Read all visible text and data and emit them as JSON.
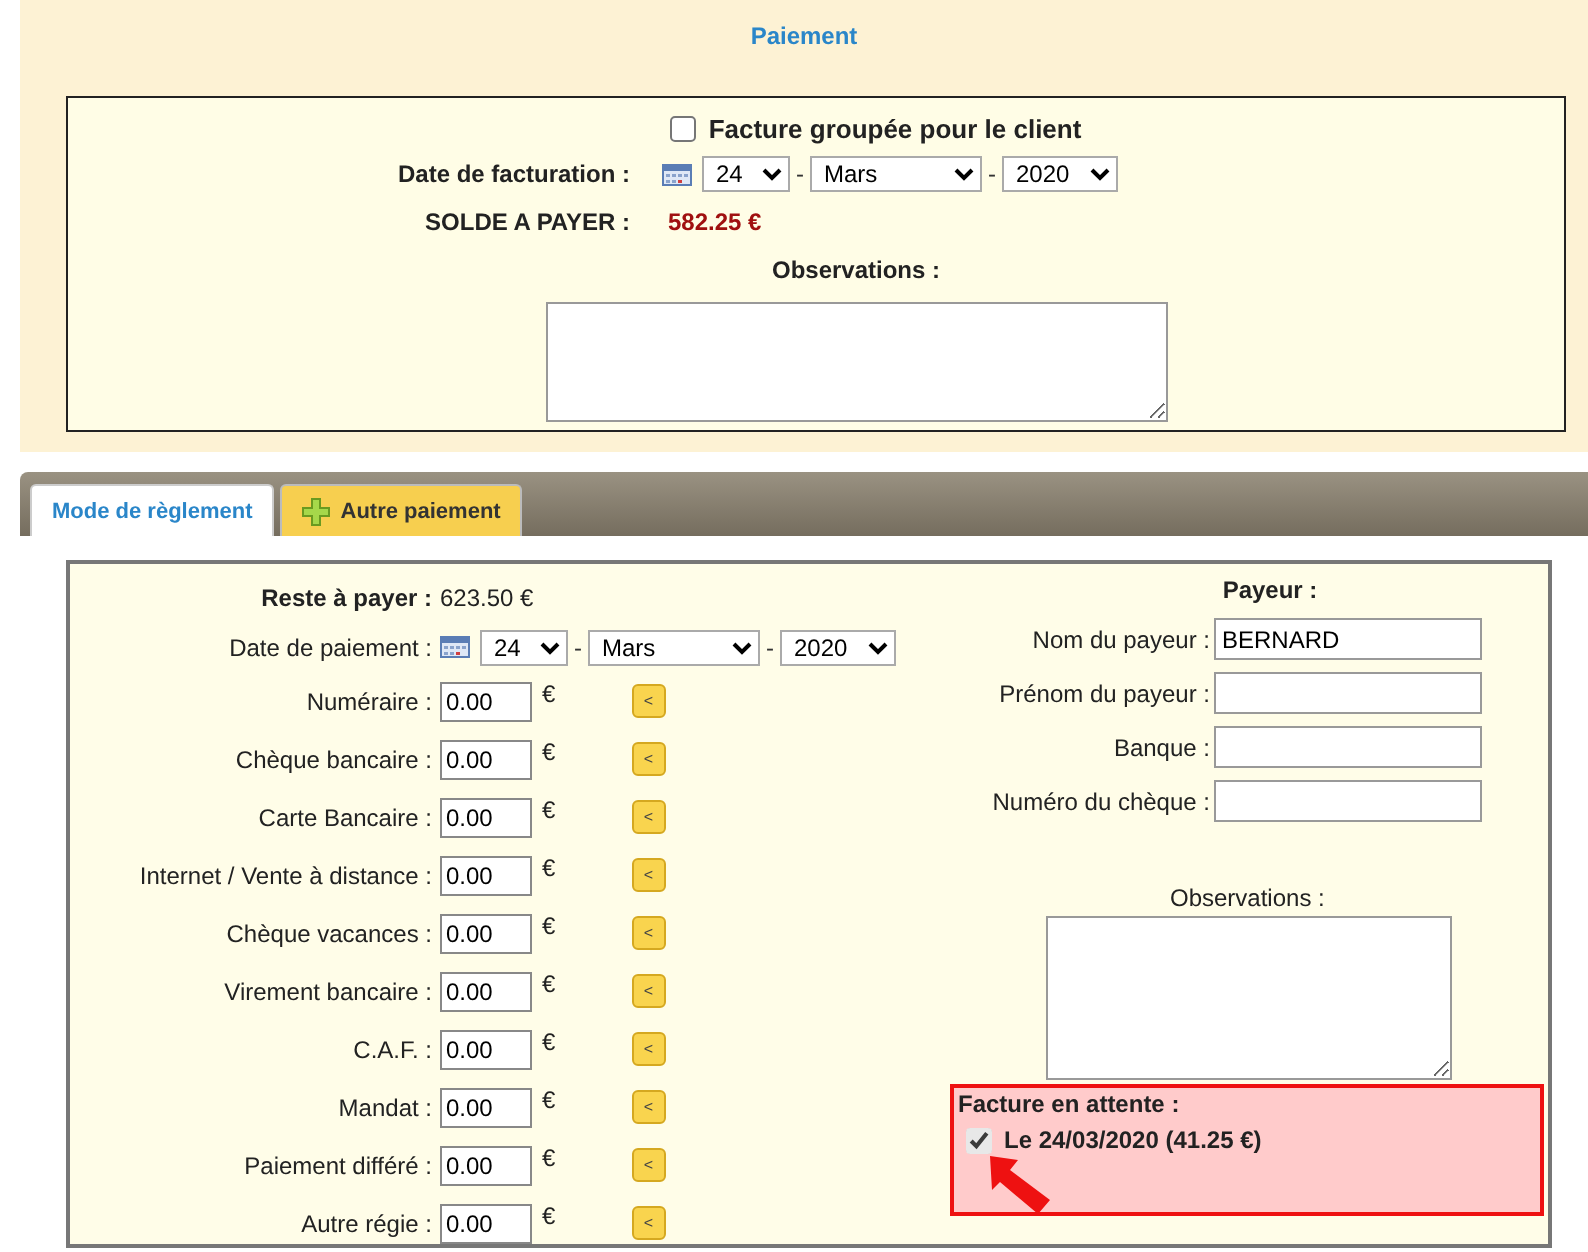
{
  "title": "Paiement",
  "invoice": {
    "grouped": {
      "label": "Facture groupée pour le client",
      "checked": false
    },
    "date_label": "Date de facturation :",
    "date": {
      "day": "24",
      "separator_1": "-",
      "month": "Mars",
      "separator_2": "-",
      "year": "2020"
    },
    "balance_label": "SOLDE A PAYER :",
    "balance": "582.25 €",
    "observations_label": "Observations :"
  },
  "tabs": [
    {
      "label": "Mode de règlement",
      "selected": true,
      "kind": "plain"
    },
    {
      "label": "Autre paiement",
      "selected": false,
      "kind": "add"
    }
  ],
  "payment": {
    "remaining_label": "Reste à payer :",
    "remaining": "623.50 €",
    "date_label": "Date de paiement :",
    "date": {
      "day": "24",
      "separator_1": "-",
      "month": "Mars",
      "separator_2": "-",
      "year": "2020"
    },
    "methods": [
      {
        "label": "Numéraire :",
        "value": "0.00",
        "currency": "€",
        "button": "<"
      },
      {
        "label": "Chèque bancaire :",
        "value": "0.00",
        "currency": "€",
        "button": "<"
      },
      {
        "label": "Carte Bancaire :",
        "value": "0.00",
        "currency": "€",
        "button": "<"
      },
      {
        "label": "Internet / Vente à distance :",
        "value": "0.00",
        "currency": "€",
        "button": "<"
      },
      {
        "label": "Chèque vacances :",
        "value": "0.00",
        "currency": "€",
        "button": "<"
      },
      {
        "label": "Virement bancaire :",
        "value": "0.00",
        "currency": "€",
        "button": "<"
      },
      {
        "label": "C.A.F. :",
        "value": "0.00",
        "currency": "€",
        "button": "<"
      },
      {
        "label": "Mandat :",
        "value": "0.00",
        "currency": "€",
        "button": "<"
      },
      {
        "label": "Paiement différé :",
        "value": "0.00",
        "currency": "€",
        "button": "<"
      },
      {
        "label": "Autre régie :",
        "value": "0.00",
        "currency": "€",
        "button": "<"
      }
    ]
  },
  "payer": {
    "title": "Payeur :",
    "fields": [
      {
        "label": "Nom du payeur :",
        "value": "BERNARD"
      },
      {
        "label": "Prénom du payeur :"
      },
      {
        "label": "Banque :"
      },
      {
        "label": "Numéro du chèque :"
      }
    ],
    "observations_label": "Observations :"
  },
  "pending": {
    "title": "Facture en attente :",
    "items": [
      {
        "label": "Le 24/03/2020 (41.25 €)",
        "checked": true
      }
    ]
  }
}
